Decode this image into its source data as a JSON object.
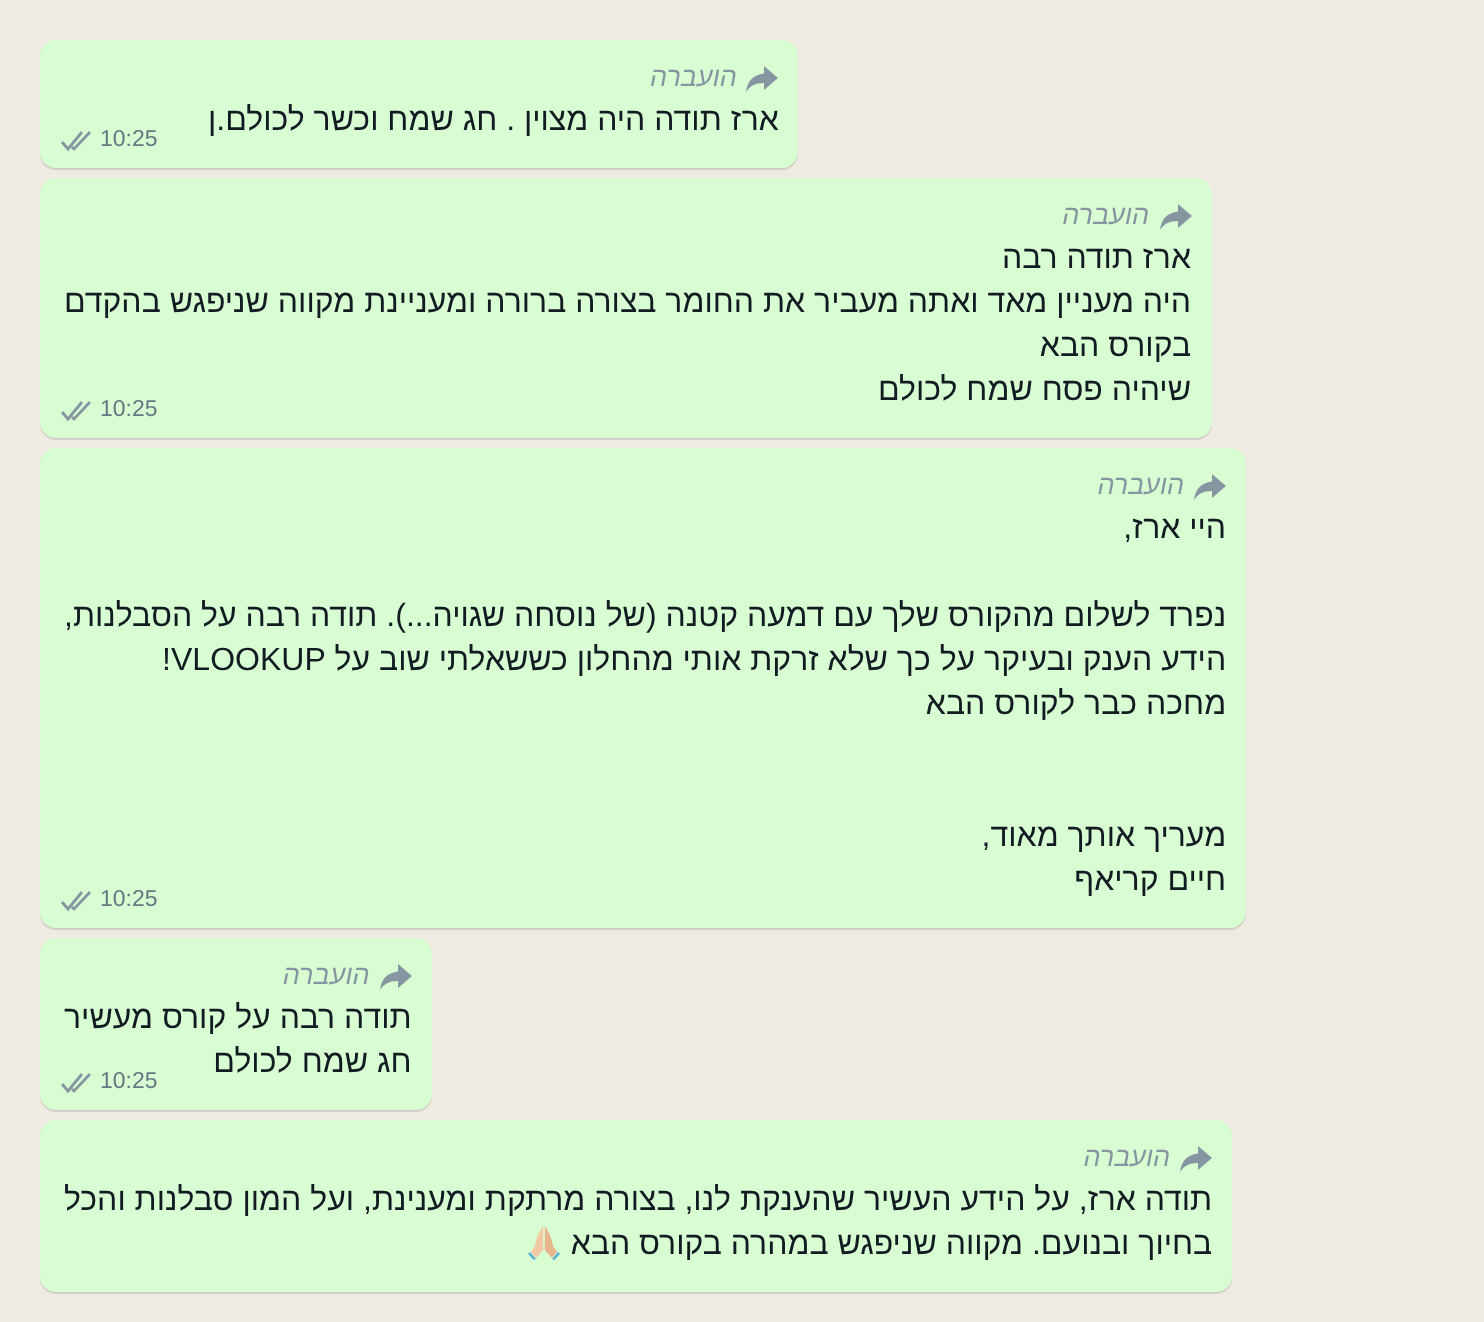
{
  "messages": [
    {
      "forwarded_label": "הועברה",
      "lines": [
        {
          "kind": "text",
          "text": "ארז תודה היה מצוין . חג שמח וכשר לכולם.ן"
        }
      ],
      "time": "10:25",
      "read": true
    },
    {
      "forwarded_label": "הועברה",
      "lines": [
        {
          "kind": "text",
          "text": "ארז תודה רבה"
        },
        {
          "kind": "text",
          "text": "היה מעניין מאד ואתה מעביר את החומר בצורה ברורה ומעניינת מקווה שניפגש בהקדם"
        },
        {
          "kind": "text",
          "text": "בקורס הבא"
        },
        {
          "kind": "text",
          "text": "שיהיה פסח שמח לכולם"
        }
      ],
      "time": "10:25",
      "read": true
    },
    {
      "forwarded_label": "הועברה",
      "lines": [
        {
          "kind": "text",
          "text": "היי ארז,"
        },
        {
          "kind": "blank"
        },
        {
          "kind": "text",
          "text": "נפרד לשלום מהקורס שלך עם דמעה קטנה (של נוסחה שגויה...). תודה רבה על הסבלנות,"
        },
        {
          "kind": "text",
          "text": "הידע הענק ובעיקר על כך שלא זרקת אותי מהחלון כששאלתי שוב על VLOOKUP!"
        },
        {
          "kind": "text",
          "text": "מחכה כבר לקורס הבא"
        },
        {
          "kind": "blank"
        },
        {
          "kind": "blank"
        },
        {
          "kind": "text",
          "text": "מעריך אותך מאוד,"
        },
        {
          "kind": "text",
          "text": "חיים קריאף"
        }
      ],
      "time": "10:25",
      "read": true
    },
    {
      "forwarded_label": "הועברה",
      "lines": [
        {
          "kind": "text",
          "text": "תודה רבה על קורס מעשיר"
        },
        {
          "kind": "text",
          "text": "חג שמח לכולם"
        }
      ],
      "time": "10:25",
      "read": true
    },
    {
      "forwarded_label": "הועברה",
      "lines": [
        {
          "kind": "text",
          "text": "תודה ארז, על הידע העשיר שהענקת לנו, בצורה מרתקת ומענינת, ועל המון סבלנות והכל"
        },
        {
          "kind": "text",
          "text": "בחיוך ובנועם. מקווה שניפגש במהרה בקורס הבא",
          "praying_hands": true
        }
      ]
    }
  ]
}
